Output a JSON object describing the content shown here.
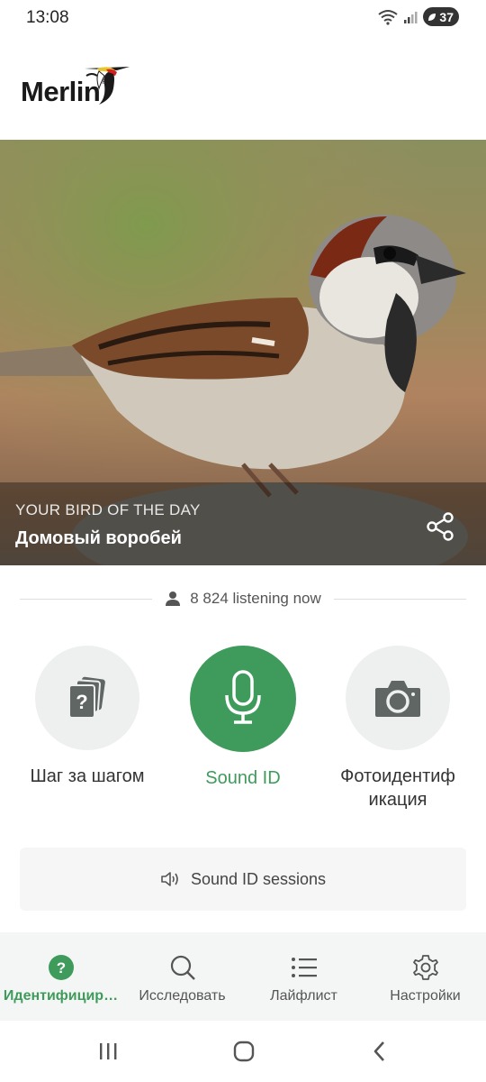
{
  "status": {
    "time": "13:08",
    "battery": "37"
  },
  "brand": {
    "name": "Merlin",
    "reg": "®"
  },
  "hero": {
    "kicker": "YOUR BIRD OF THE DAY",
    "title": "Домовый воробей"
  },
  "listening": {
    "text": "8 824 listening now"
  },
  "actions": [
    {
      "label": "Шаг за шагом",
      "icon": "question-cards-icon"
    },
    {
      "label": "Sound ID",
      "icon": "microphone-icon"
    },
    {
      "label": "Фотоидентиф\nикация",
      "icon": "camera-icon"
    }
  ],
  "sessions": {
    "label": "Sound ID sessions",
    "icon": "speaker-icon"
  },
  "nav": [
    {
      "label": "Идентифицир…",
      "icon": "question-circle-icon",
      "active": true
    },
    {
      "label": "Исследовать",
      "icon": "search-icon",
      "active": false
    },
    {
      "label": "Лайфлист",
      "icon": "list-icon",
      "active": false
    },
    {
      "label": "Настройки",
      "icon": "gear-icon",
      "active": false
    }
  ],
  "colors": {
    "accent": "#3f9b5b",
    "button_bg": "#eef0ef",
    "nav_bg": "#f4f6f5"
  }
}
